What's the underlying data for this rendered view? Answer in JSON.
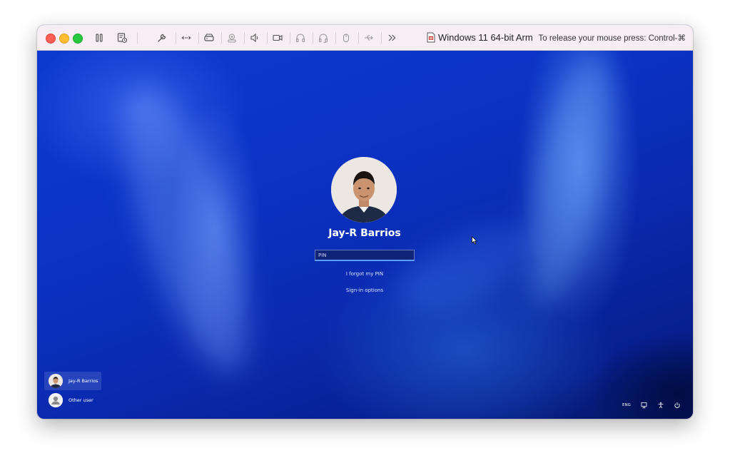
{
  "titlebar": {
    "vm_name": "Windows 11 64-bit Arm",
    "release_hint": "To release your mouse press: Control-⌘",
    "toolbar_icons": [
      "pause-icon",
      "snapshot-icon",
      "settings-wrench-icon",
      "network-icon",
      "hard-disk-icon",
      "camera-sharing-icon",
      "sound-icon",
      "video-camera-icon",
      "headphones-icon",
      "headset-icon",
      "mouse-icon",
      "usb-icon",
      "more-chevrons-icon"
    ]
  },
  "login": {
    "user_name": "Jay-R Barrios",
    "pin_placeholder": "PIN",
    "forgot_pin": "I forgot my PIN",
    "sign_in_options": "Sign-in options"
  },
  "user_list": [
    {
      "label": "Jay-R Barrios",
      "selected": true
    },
    {
      "label": "Other user",
      "selected": false
    }
  ],
  "tray": {
    "language": "ENG",
    "icons": [
      "network-icon",
      "accessibility-icon",
      "power-icon"
    ]
  },
  "colors": {
    "accent": "#5aa0ff",
    "wallpaper": "#0b33c4",
    "titlebar": "#f6eef3"
  }
}
